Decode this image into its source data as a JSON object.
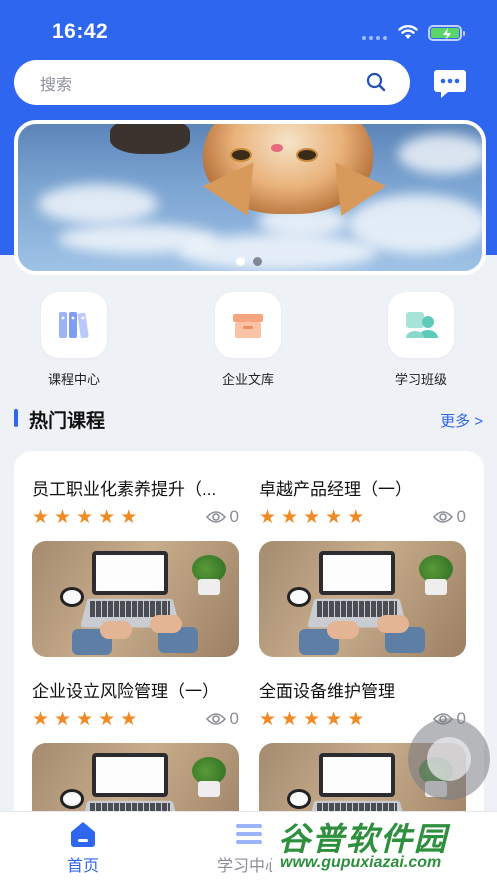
{
  "status_bar": {
    "time": "16:42"
  },
  "search": {
    "placeholder": "搜索"
  },
  "banner": {
    "active_index": 0,
    "count": 2
  },
  "quick_links": [
    {
      "label": "课程中心",
      "icon": "books-icon"
    },
    {
      "label": "企业文库",
      "icon": "file-box-icon"
    },
    {
      "label": "学习班级",
      "icon": "class-people-icon"
    }
  ],
  "hot_courses": {
    "title": "热门课程",
    "more": "更多 >",
    "items": [
      {
        "title": "员工职业化素养提升（...",
        "rating": 5,
        "views": "0"
      },
      {
        "title": "卓越产品经理（一）",
        "rating": 5,
        "views": "0"
      },
      {
        "title": "企业设立风险管理（一）",
        "rating": 5,
        "views": "0"
      },
      {
        "title": "全面设备维护管理",
        "rating": 5,
        "views": "0"
      }
    ]
  },
  "tab_bar": {
    "tabs": [
      {
        "label": "首页",
        "icon": "home-icon",
        "active": true
      },
      {
        "label": "学习中心",
        "icon": "study-list-icon",
        "active": false
      }
    ]
  },
  "watermark": {
    "title": "谷普软件园",
    "url": "www.gupuxiazai.com"
  },
  "colors": {
    "primary": "#2f66f0",
    "star": "#f08a24",
    "background": "#eef1f6"
  }
}
